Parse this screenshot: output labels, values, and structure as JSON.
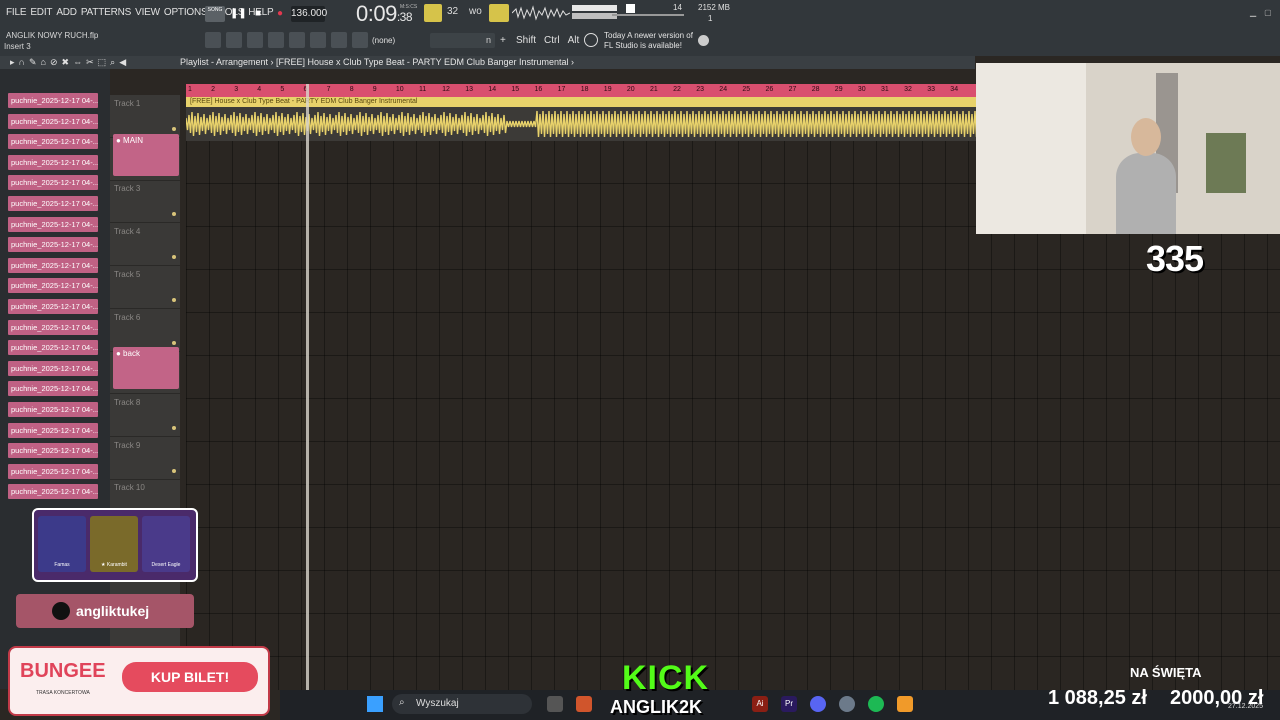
{
  "menu": [
    "FILE",
    "EDIT",
    "ADD",
    "PATTERNS",
    "VIEW",
    "OPTIONS",
    "TOOLS",
    "HELP"
  ],
  "project": {
    "filename": "ANGLIK NOWY RUCH.flp",
    "insert": "Insert 3"
  },
  "transport": {
    "mode": "SONG",
    "bpm": "136.000",
    "time_main": "0:09",
    "time_frac": "38",
    "time_units": "M:S:CS"
  },
  "monitor": {
    "cpu": "14",
    "memory": "2152 MB",
    "poly": "1"
  },
  "toolbar": {
    "pattern": "(none)",
    "pattern_field": "n",
    "modifiers": [
      "Shift",
      "Ctrl",
      "Alt"
    ]
  },
  "update_notice": {
    "line1": "Today  A newer version of",
    "line2": "FL Studio is available!"
  },
  "playlist": {
    "breadcrumb": "Playlist - Arrangement  ›  [FREE] House x Club Type Beat - PARTY  EDM Club Banger Instrumental  ›",
    "clip_title": "[FREE] House x Club Type Beat - PARTY  EDM Club Banger Instrumental",
    "ruler": [
      "1",
      "2",
      "3",
      "4",
      "5",
      "6",
      "7",
      "8",
      "9",
      "10",
      "11",
      "12",
      "13",
      "14",
      "15",
      "16",
      "17",
      "18",
      "19",
      "20",
      "21",
      "22",
      "23",
      "24",
      "25",
      "26",
      "27",
      "28",
      "29",
      "30",
      "31",
      "32",
      "33",
      "34"
    ],
    "playhead_bar": 6.2
  },
  "tracks": [
    "Track 1",
    "MAIN",
    "Track 3",
    "Track 4",
    "Track 5",
    "Track 6",
    "back",
    "Track 8",
    "Track 9",
    "Track 10"
  ],
  "browser_items": [
    "puchnie_2025-12-17 04-...",
    "puchnie_2025-12-17 04-...",
    "puchnie_2025-12-17 04-...",
    "puchnie_2025-12-17 04-...",
    "puchnie_2025-12-17 04-...",
    "puchnie_2025-12-17 04-...",
    "puchnie_2025-12-17 04-...",
    "puchnie_2025-12-17 04-...",
    "puchnie_2025-12-17 04-...",
    "puchnie_2025-12-17 04-...",
    "puchnie_2025-12-17 04-...",
    "puchnie_2025-12-17 04-...",
    "puchnie_2025-12-17 04-...",
    "puchnie_2025-12-17 04-...",
    "puchnie_2025-12-17 04-...",
    "puchnie_2025-12-17 04-...",
    "puchnie_2025-12-17 04-...",
    "puchnie_2025-12-17 04-...",
    "puchnie_2025-12-17 04-...",
    "puchnie_2025-12-17 04-..."
  ],
  "overlay": {
    "counter": "335",
    "tiktok": "angliktukej",
    "cards": [
      "Famas",
      "★ Karambit",
      "Desert Eagle"
    ],
    "bungee_logo": "BUNGEE",
    "bungee_sub": "TRASA KONCERTOWA",
    "bungee_button": "KUP BILET!",
    "kick": "KICK",
    "kick_name": "ANGLIK2K",
    "goal_label": "NA ŚWIĘTA",
    "goal_current": "1 088,25 zł",
    "goal_target": "2000,00 zł"
  },
  "taskbar": {
    "search": "Wyszukaj",
    "date": "27.12.2025"
  },
  "colors": {
    "ruler": "#d94f6f",
    "clip": "#e8d26b",
    "browser_item": "#c06184",
    "kick": "#53fc18"
  }
}
